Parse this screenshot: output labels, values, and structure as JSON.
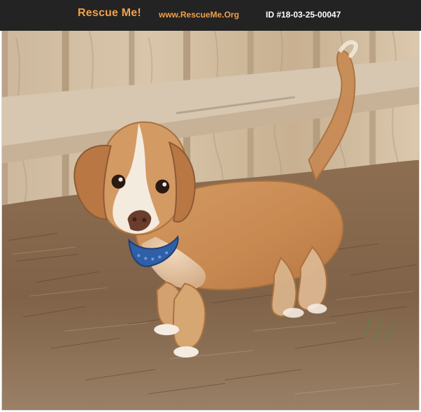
{
  "header": {
    "brand": "Rescue Me!",
    "site": "www.RescueMe.Org",
    "id_label": "ID #18-03-25-00047"
  },
  "photo": {
    "subject": "dog-photo"
  },
  "colors": {
    "header_bg": "#232323",
    "brand": "#f0a14a",
    "id_text": "#ffffff"
  }
}
